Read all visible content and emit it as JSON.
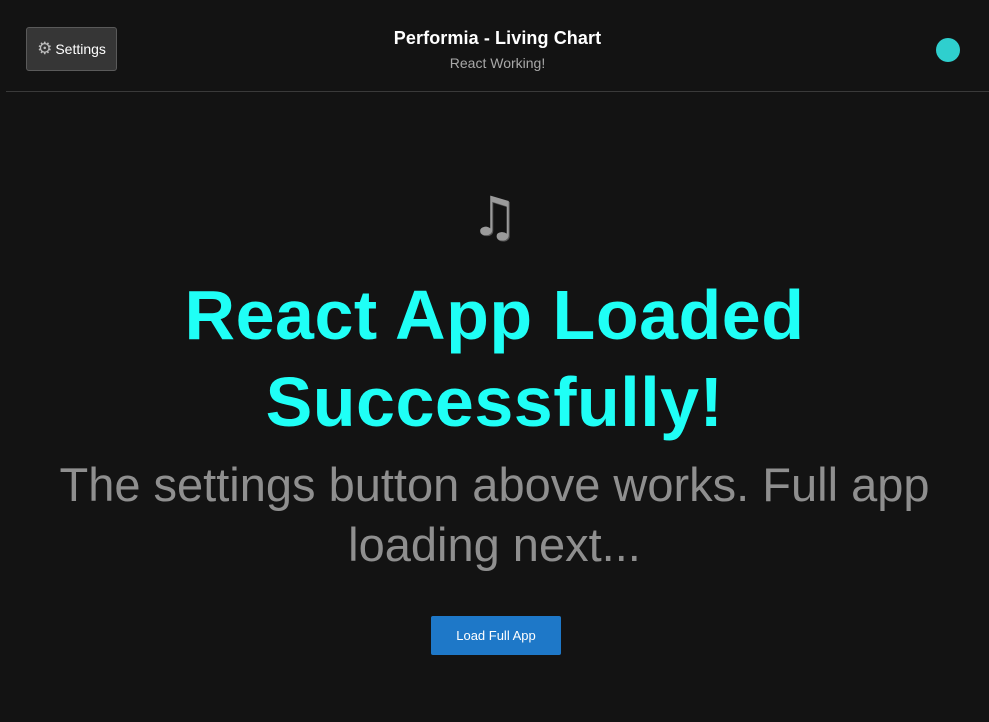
{
  "header": {
    "settings_icon": "gear-icon",
    "settings_label": "Settings",
    "title": "Performia - Living Chart",
    "subtitle": "React Working!",
    "status_color": "#2fcfce"
  },
  "main": {
    "icon": "music-notes-icon",
    "heading": "React App Loaded Successfully!",
    "description": "The settings button above works. Full app loading next...",
    "load_button_label": "Load Full App"
  },
  "colors": {
    "background": "#131313",
    "heading": "#1ffff6",
    "accent_button": "#1e78c8"
  }
}
